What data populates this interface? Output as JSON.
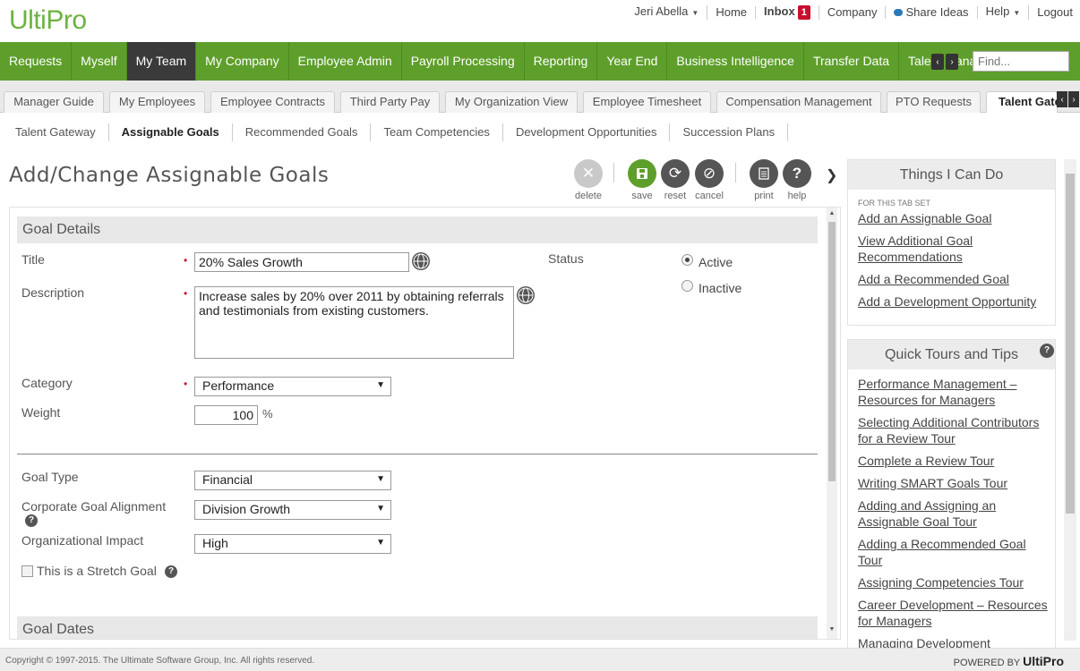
{
  "brand": {
    "logo": "UltiPro",
    "footer_logo": "UltiPro"
  },
  "header": {
    "user": "Jeri Abella",
    "home": "Home",
    "inbox": "Inbox",
    "inbox_count": "1",
    "company": "Company",
    "share_ideas": "Share Ideas",
    "help": "Help",
    "logout": "Logout"
  },
  "mainnav": {
    "items": [
      "Requests",
      "Myself",
      "My Team",
      "My Company",
      "Employee Admin",
      "Payroll Processing",
      "Reporting",
      "Year End",
      "Business Intelligence",
      "Transfer Data",
      "Talent Manager"
    ],
    "active": "My Team",
    "find_placeholder": "Find..."
  },
  "tabs": {
    "items": [
      "Manager Guide",
      "My Employees",
      "Employee Contracts",
      "Third Party Pay",
      "My Organization View",
      "Employee Timesheet",
      "Compensation Management",
      "PTO Requests",
      "Talent Gateway"
    ],
    "active": "Talent Gateway"
  },
  "subnav": {
    "items": [
      "Talent Gateway",
      "Assignable Goals",
      "Recommended Goals",
      "Team Competencies",
      "Development Opportunities",
      "Succession Plans"
    ],
    "active": "Assignable Goals"
  },
  "page": {
    "title": "Add/Change Assignable Goals"
  },
  "toolbar": {
    "delete": "delete",
    "save": "save",
    "reset": "reset",
    "cancel": "cancel",
    "print": "print",
    "help": "help"
  },
  "goal_details": {
    "section_title": "Goal Details",
    "title_label": "Title",
    "title_value": "20% Sales Growth",
    "description_label": "Description",
    "description_value": "Increase sales by 20% over 2011 by obtaining referrals and testimonials from existing customers.",
    "status_label": "Status",
    "status_active": "Active",
    "status_inactive": "Inactive",
    "category_label": "Category",
    "category_value": "Performance",
    "weight_label": "Weight",
    "weight_value": "100",
    "weight_unit": "%",
    "goal_type_label": "Goal Type",
    "goal_type_value": "Financial",
    "alignment_label": "Corporate Goal Alignment",
    "alignment_value": "Division Growth",
    "impact_label": "Organizational Impact",
    "impact_value": "High",
    "stretch_label": "This is a Stretch Goal"
  },
  "goal_dates": {
    "section_title": "Goal Dates"
  },
  "sidebar": {
    "things_title": "Things I Can Do",
    "things_caption": "FOR THIS TAB SET",
    "things_links": [
      "Add an Assignable Goal",
      "View Additional Goal Recommendations",
      "Add a Recommended Goal",
      "Add a Development Opportunity"
    ],
    "tours_title": "Quick Tours and Tips",
    "tours_links": [
      "Performance Management – Resources for Managers",
      "Selecting Additional Contributors for a Review Tour",
      "Complete a Review Tour",
      "Writing SMART Goals Tour",
      "Adding and Assigning an Assignable Goal Tour",
      "Adding a Recommended Goal Tour",
      "Assigning Competencies Tour",
      "Career Development – Resources for Managers",
      "Managing Development"
    ]
  },
  "footer": {
    "copyright": "Copyright © 1997-2015. The Ultimate Software Group, Inc. All rights reserved.",
    "powered_by": "POWERED BY"
  },
  "colors": {
    "brand_green": "#5e9f2b",
    "logo_green": "#6cb33f",
    "save_green": "#5e9f2b",
    "badge_red": "#c8102e"
  }
}
